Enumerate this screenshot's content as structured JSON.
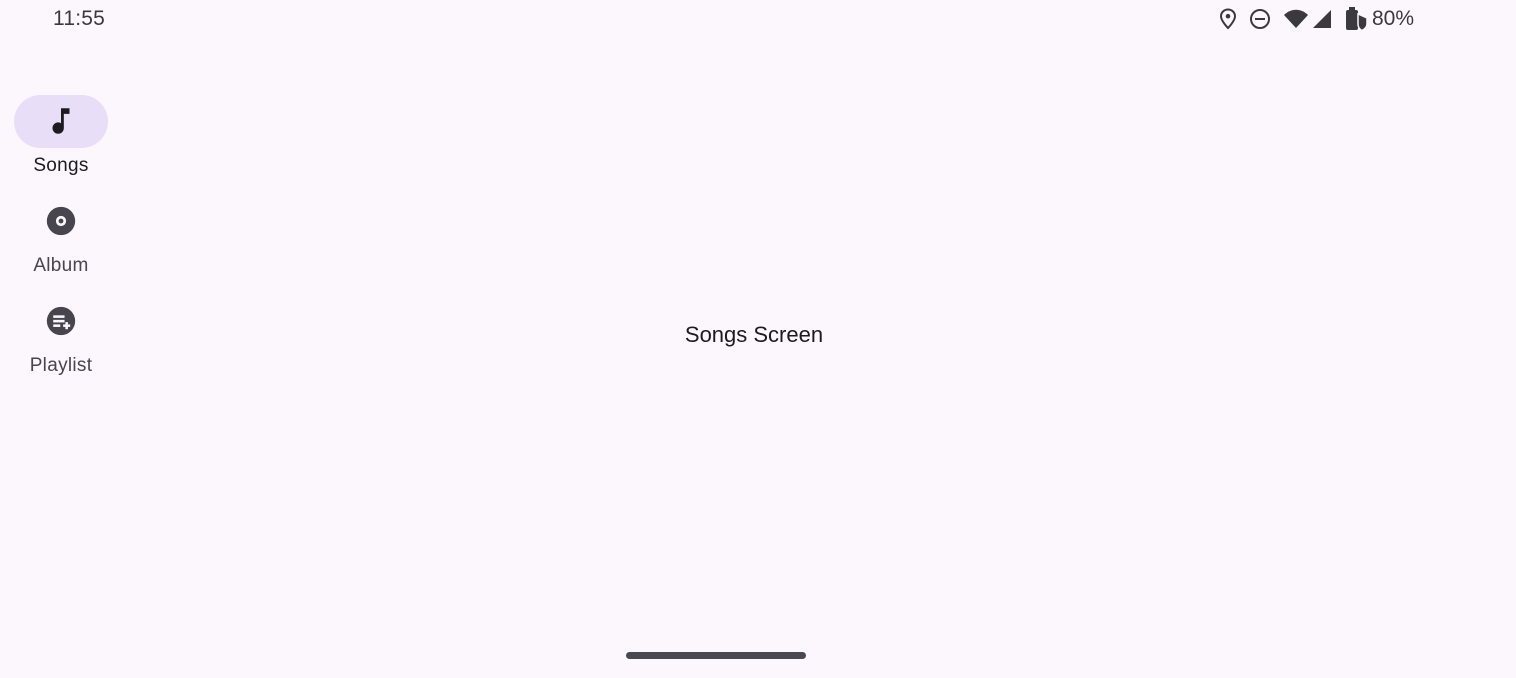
{
  "status_bar": {
    "time": "11:55",
    "battery_percent": "80%",
    "icons": [
      "location-icon",
      "do-not-disturb-icon",
      "wifi-icon",
      "cell-signal-icon",
      "battery-charging-icon"
    ]
  },
  "nav_rail": {
    "selected": "Songs",
    "items": [
      {
        "label": "Songs",
        "icon": "music-note-icon",
        "selected": true
      },
      {
        "label": "Album",
        "icon": "album-icon",
        "selected": false
      },
      {
        "label": "Playlist",
        "icon": "playlist-add-icon",
        "selected": false
      }
    ]
  },
  "main": {
    "text": "Songs Screen"
  },
  "colors": {
    "background": "#fcf7fc",
    "nav_indicator": "#e8def8",
    "icon": "#49454f",
    "text": "#1d1b20"
  }
}
